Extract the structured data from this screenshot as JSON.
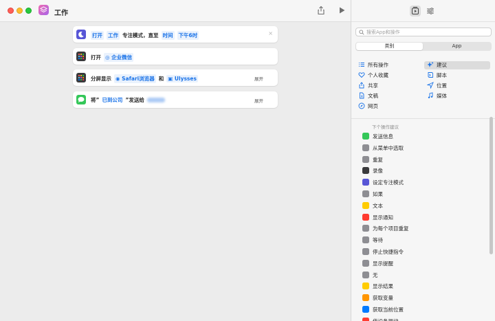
{
  "window": {
    "title": "工作"
  },
  "actions": [
    {
      "id": "focus",
      "parts": [
        {
          "t": "打开",
          "s": "tok"
        },
        {
          "t": "工作",
          "s": "tok"
        },
        {
          "t": "专注模式，直至",
          "s": "plain"
        },
        {
          "t": "时间",
          "s": "tok"
        },
        {
          "t": "下午6时",
          "s": "tok"
        }
      ],
      "expand": "",
      "close": "×"
    },
    {
      "id": "open-app",
      "parts": [
        {
          "t": "打开",
          "s": "plain"
        },
        {
          "t": "◎ 企业微信",
          "s": "tok"
        }
      ],
      "expand": "",
      "close": ""
    },
    {
      "id": "split",
      "parts": [
        {
          "t": "分屏显示",
          "s": "plain"
        },
        {
          "t": "◉ Safari浏览器",
          "s": "tok"
        },
        {
          "t": "和",
          "s": "plain"
        },
        {
          "t": "▣ Ulysses",
          "s": "tok"
        }
      ],
      "expand": "展开",
      "close": ""
    },
    {
      "id": "message",
      "parts": [
        {
          "t": "将”",
          "s": "plain"
        },
        {
          "t": "已到公司",
          "s": "plain-blue"
        },
        {
          "t": "”发送给",
          "s": "plain"
        },
        {
          "t": "",
          "s": "blur"
        }
      ],
      "expand": "展开",
      "close": ""
    }
  ],
  "search": {
    "placeholder": "搜索App和操作"
  },
  "segment": {
    "left": "类别",
    "right": "App"
  },
  "categories": {
    "all": "所有操作",
    "suggest": "建议",
    "favorites": "个人收藏",
    "scripting": "脚本",
    "sharing": "共享",
    "location": "位置",
    "documents": "文稿",
    "media": "媒体",
    "web": "网页"
  },
  "suggestions_header": "下个操作建议",
  "suggestions": [
    {
      "label": "发送信息",
      "color": "#34c759"
    },
    {
      "label": "从菜单中选取",
      "color": "#8e8e93"
    },
    {
      "label": "重复",
      "color": "#8e8e93"
    },
    {
      "label": "录像",
      "color": "#3a3a3c"
    },
    {
      "label": "设定专注模式",
      "color": "#5856d6"
    },
    {
      "label": "如果",
      "color": "#8e8e93"
    },
    {
      "label": "文本",
      "color": "#ffcc00"
    },
    {
      "label": "显示通知",
      "color": "#ff3b30"
    },
    {
      "label": "为每个项目重复",
      "color": "#8e8e93"
    },
    {
      "label": "等待",
      "color": "#8e8e93"
    },
    {
      "label": "停止快捷指令",
      "color": "#8e8e93"
    },
    {
      "label": "显示提醒",
      "color": "#8e8e93"
    },
    {
      "label": "无",
      "color": "#8e8e93"
    },
    {
      "label": "显示结果",
      "color": "#ffcc00"
    },
    {
      "label": "获取变量",
      "color": "#ff9500"
    },
    {
      "label": "获取当前位置",
      "color": "#007aff"
    },
    {
      "label": "使设备振动",
      "color": "#ff3b30"
    }
  ]
}
